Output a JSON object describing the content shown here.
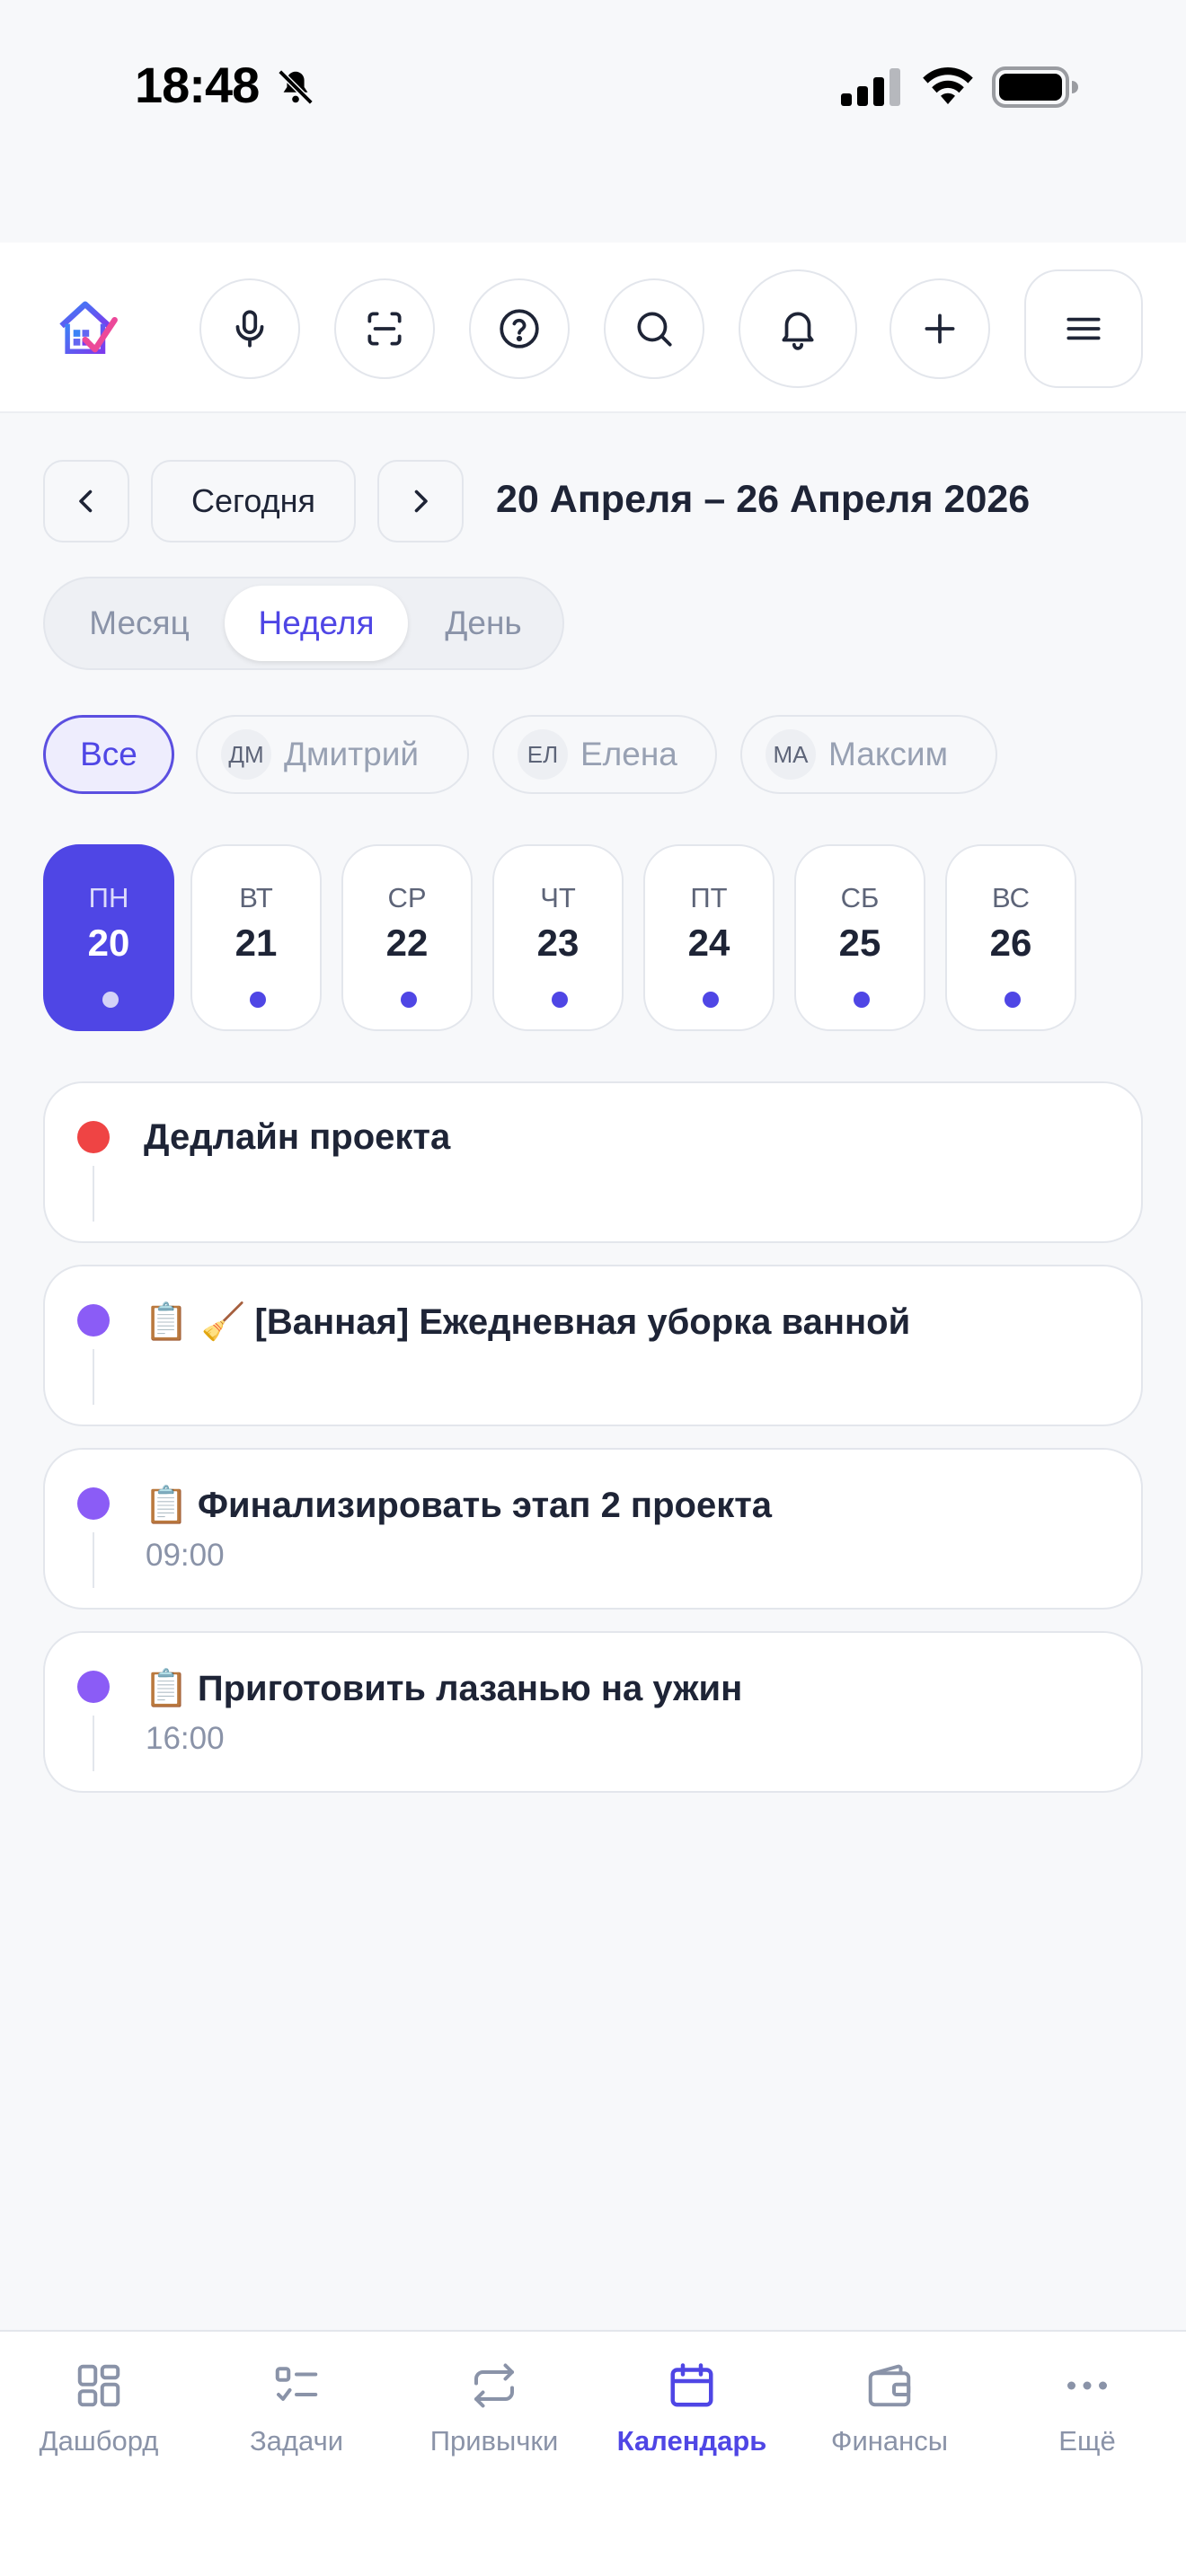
{
  "status_bar": {
    "time": "18:48"
  },
  "header": {
    "buttons": [
      "microphone-icon",
      "scan-icon",
      "help-icon",
      "search-icon",
      "bell-icon",
      "plus-icon",
      "menu-icon"
    ]
  },
  "week_nav": {
    "today_label": "Сегодня",
    "range": "20 Апреля – 26 Апреля 2026"
  },
  "view_modes": [
    {
      "label": "Месяц",
      "active": false
    },
    {
      "label": "Неделя",
      "active": true
    },
    {
      "label": "День",
      "active": false
    }
  ],
  "members": {
    "all_label": "Все",
    "list": [
      {
        "initials": "ДМ",
        "name": "Дмитрий"
      },
      {
        "initials": "ЕЛ",
        "name": "Елена"
      },
      {
        "initials": "МА",
        "name": "Максим"
      }
    ]
  },
  "days": [
    {
      "name": "ПН",
      "num": "20",
      "selected": true
    },
    {
      "name": "ВТ",
      "num": "21",
      "selected": false
    },
    {
      "name": "СР",
      "num": "22",
      "selected": false
    },
    {
      "name": "ЧТ",
      "num": "23",
      "selected": false
    },
    {
      "name": "ПТ",
      "num": "24",
      "selected": false
    },
    {
      "name": "СБ",
      "num": "25",
      "selected": false
    },
    {
      "name": "ВС",
      "num": "26",
      "selected": false
    }
  ],
  "events": [
    {
      "emoji": "",
      "title": "Дедлайн проекта",
      "time": "",
      "color": "#ef4444"
    },
    {
      "emoji": "📋 🧹",
      "title": "[Ванная] Ежедневная уборка ванной",
      "time": "",
      "color": "#8b5cf6"
    },
    {
      "emoji": "📋",
      "title": "Финализировать этап 2 проекта",
      "time": "09:00",
      "color": "#8b5cf6"
    },
    {
      "emoji": "📋",
      "title": "Приготовить лазанью на ужин",
      "time": "16:00",
      "color": "#8b5cf6"
    }
  ],
  "bottom_nav": [
    {
      "label": "Дашборд",
      "icon": "dashboard-icon",
      "active": false
    },
    {
      "label": "Задачи",
      "icon": "tasks-icon",
      "active": false
    },
    {
      "label": "Привычки",
      "icon": "habits-icon",
      "active": false
    },
    {
      "label": "Календарь",
      "icon": "calendar-icon",
      "active": true
    },
    {
      "label": "Финансы",
      "icon": "wallet-icon",
      "active": false
    },
    {
      "label": "Ещё",
      "icon": "more-icon",
      "active": false
    }
  ],
  "colors": {
    "accent": "#4f46e5",
    "deadline": "#ef4444",
    "task": "#8b5cf6"
  }
}
